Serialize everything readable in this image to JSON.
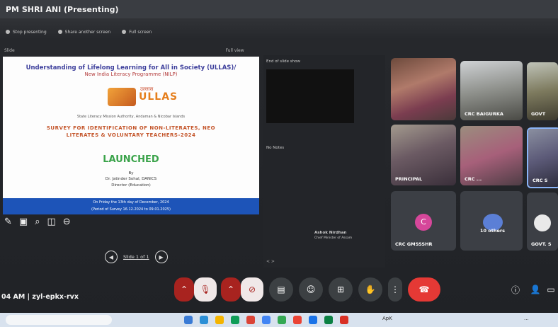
{
  "window": {
    "title": "PM SHRI ANI (Presenting)"
  },
  "toolbar": {
    "items": [
      "Stop presenting",
      "Share another screen",
      "Full screen"
    ]
  },
  "subbar": {
    "left": "Slide",
    "right": "Full view"
  },
  "slide": {
    "heading": "Understanding of Lifelong Learning for All in Society (ULLAS)/",
    "subheading": "New India Literacy Programme (NILP)",
    "logo_hindi": "उल्लास",
    "logo_text": "ULLAS",
    "authority": "State Literacy Mission Authority, Andaman & Nicobar Islands",
    "survey_line1": "SURVEY FOR IDENTIFICATION OF NON-LITERATES, NEO",
    "survey_line2": "LITERATES & VOLUNTARY TEACHERS-2024",
    "launched": "LAUNCHED",
    "by": "By",
    "person": "Dr. Jatinder Sohal, DANICS",
    "role": "Director (Education)",
    "band1": "On Friday the 13th day of December, 2024",
    "band2": "(Period of Survey 16.12.2024 to 09.01.2025)"
  },
  "slide_nav": {
    "label": "Slide 1 of 1"
  },
  "side_panel": {
    "top_label": "End of slide show",
    "mid_label": "No Notes",
    "person_line1": "Ashok Nirdhan",
    "person_line2": "Chief Minister of Assam",
    "bottom": "< >"
  },
  "tiles": [
    {
      "name": ""
    },
    {
      "name": "CRC BAIGURKA"
    },
    {
      "name": "GOVT"
    },
    {
      "name": "PRINCIPAL"
    },
    {
      "name": "CRC ..."
    },
    {
      "name": "CRC S"
    },
    {
      "name": "CRC GMSSSHR",
      "avatar": "C"
    },
    {
      "name": "10 others"
    },
    {
      "name": "GOVT. S"
    }
  ],
  "meeting_code": "04 AM | zyl-epkx-rvx",
  "colors": {
    "accent_blue": "#1d54b8",
    "end_call": "#e53935",
    "mic_red": "#a8231f",
    "launched_green": "#3aa34a"
  },
  "taskbar": {
    "apps_text": "ApK",
    "time": "..."
  }
}
